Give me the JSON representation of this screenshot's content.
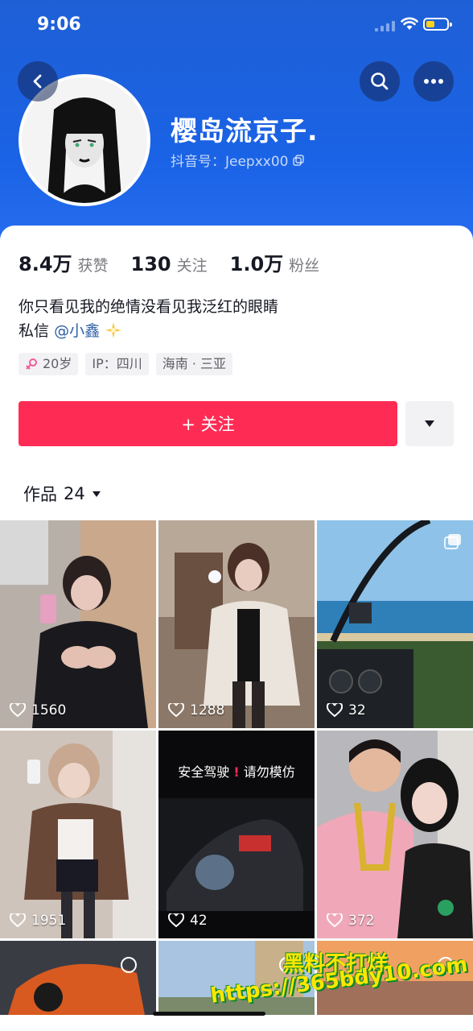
{
  "status_bar": {
    "time": "9:06"
  },
  "profile": {
    "name": "樱岛流京子.",
    "douyin_id": "抖音号：Jeepxx00",
    "stats": [
      {
        "num": "8.4万",
        "label": "获赞"
      },
      {
        "num": "130",
        "label": "关注"
      },
      {
        "num": "1.0万",
        "label": "粉丝"
      }
    ],
    "bio_line1": "你只看见我的绝情没看见我泛红的眼睛",
    "bio_line2_prefix": "私信",
    "bio_mention": "@小鑫",
    "tags": [
      "20岁",
      "IP：四川",
      "海南 · 三亚"
    ],
    "follow_label": "+ 关注"
  },
  "works": {
    "label": "作品",
    "count": "24"
  },
  "grid": [
    {
      "likes": "1560"
    },
    {
      "likes": "1288"
    },
    {
      "likes": "32"
    },
    {
      "likes": "1951"
    },
    {
      "likes": "42",
      "overlay_a": "安全驾驶",
      "overlay_b": "请勿模仿"
    },
    {
      "likes": "372"
    }
  ],
  "watermark": {
    "line1": "黑料不打烊",
    "line2": "https://365bdy10.com"
  },
  "colors": {
    "header_blue": "#1a63e6",
    "follow_red": "#fe2c55",
    "mention_blue": "#2d5fa6"
  },
  "icons": {
    "back": "chevron-left-icon",
    "search": "search-icon",
    "more": "more-horizontal-icon"
  }
}
